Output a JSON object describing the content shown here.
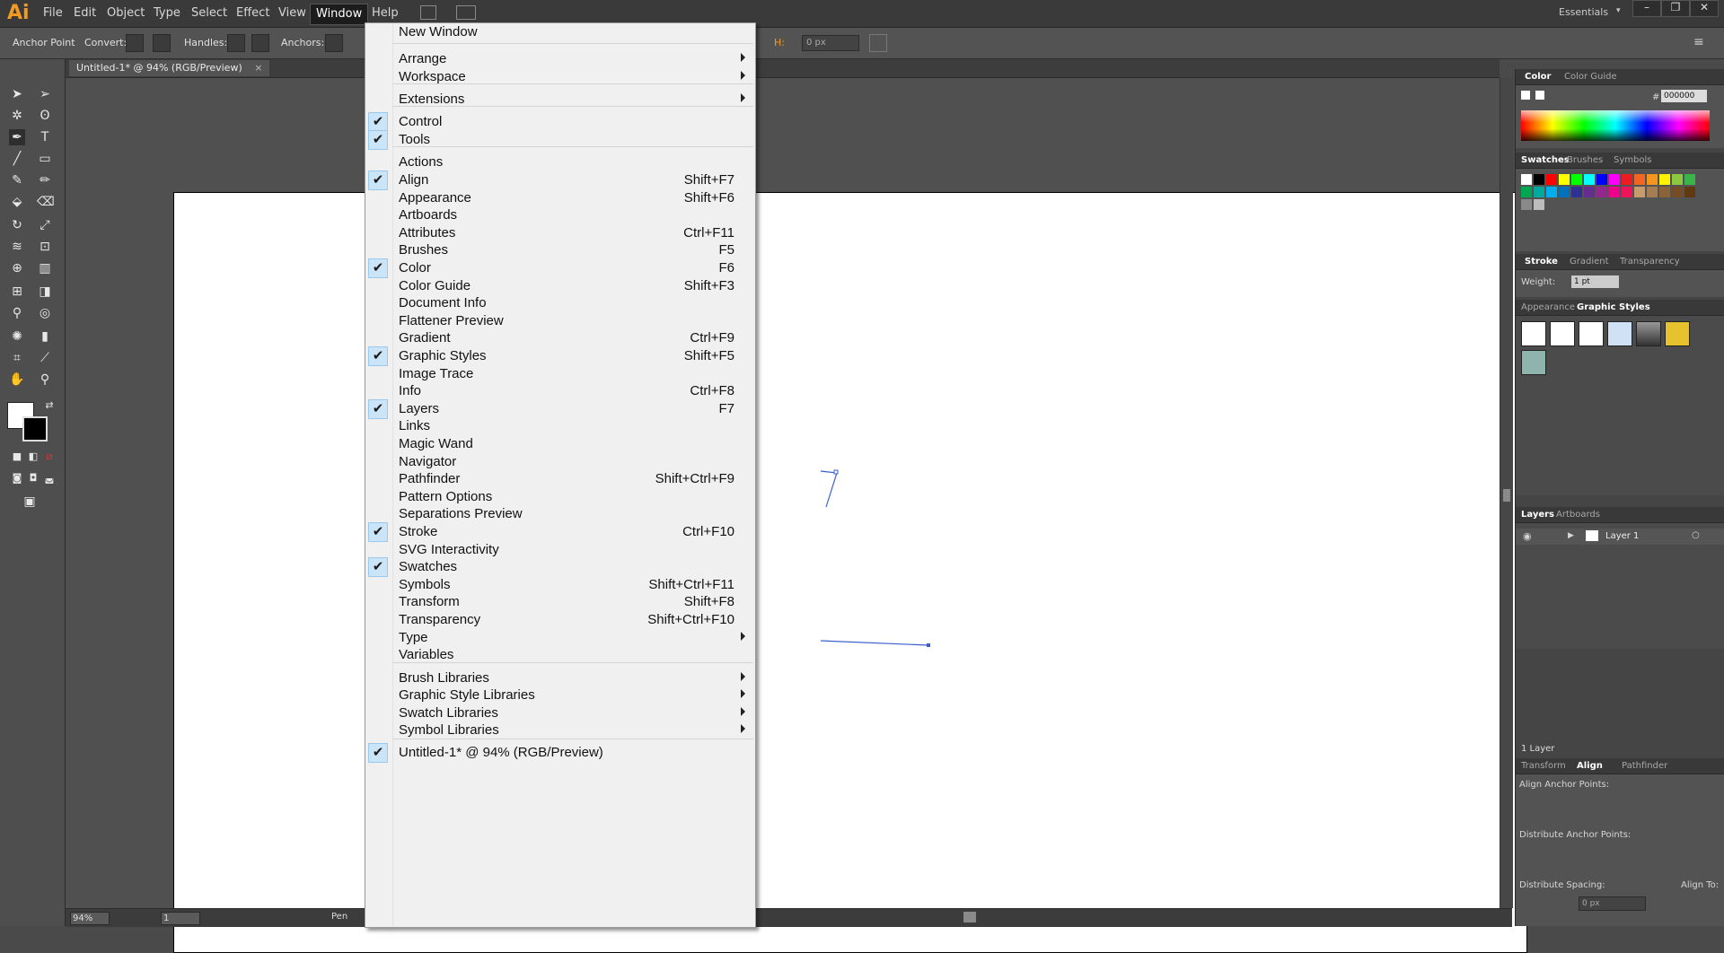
{
  "app": {
    "logo": "Ai",
    "menus": [
      "File",
      "Edit",
      "Object",
      "Type",
      "Select",
      "Effect",
      "View",
      "Window",
      "Help"
    ],
    "active_menu": "Window",
    "workspace": "Essentials",
    "window_buttons": [
      "–",
      "❐",
      "✕"
    ]
  },
  "controlbar": {
    "label": "Anchor Point",
    "convert": "Convert:",
    "handles": "Handles:",
    "anchors": "Anchors:",
    "h_label": "H:",
    "h_value": "0 px"
  },
  "document": {
    "tab": "Untitled-1* @ 94% (RGB/Preview)",
    "zoom": "94%",
    "artboard_num": "1",
    "status_tool": "Pen"
  },
  "panels": {
    "color": {
      "tabs": [
        "Color",
        "Color Guide"
      ],
      "hex_symbol": "#",
      "hex": "000000"
    },
    "swatches": {
      "tabs": [
        "Swatches",
        "Brushes",
        "Symbols"
      ]
    },
    "stroke": {
      "tabs": [
        "Stroke",
        "Gradient",
        "Transparency"
      ],
      "weight_label": "Weight:",
      "weight": "1 pt"
    },
    "graphic_styles": {
      "tabs": [
        "Appearance",
        "Graphic Styles"
      ]
    },
    "layers": {
      "tabs": [
        "Layers",
        "Artboards"
      ],
      "layer_name": "Layer 1",
      "count": "1 Layer"
    },
    "align": {
      "tabs": [
        "Transform",
        "Align",
        "Pathfinder"
      ],
      "align_anchor": "Align Anchor Points:",
      "distribute_anchor": "Distribute Anchor Points:",
      "distribute_spacing": "Distribute Spacing:",
      "align_to": "Align To:",
      "spacing_value": "0 px"
    }
  },
  "window_menu": {
    "items": [
      {
        "label": "New Window",
        "shortcut": "",
        "checked": false,
        "submenu": false
      },
      {
        "label": "Arrange",
        "shortcut": "",
        "checked": false,
        "submenu": true
      },
      {
        "label": "Workspace",
        "shortcut": "",
        "checked": false,
        "submenu": true
      },
      {
        "label": "Extensions",
        "shortcut": "",
        "checked": false,
        "submenu": true
      },
      {
        "label": "Control",
        "shortcut": "",
        "checked": true,
        "submenu": false
      },
      {
        "label": "Tools",
        "shortcut": "",
        "checked": true,
        "submenu": false
      },
      {
        "label": "Actions",
        "shortcut": "",
        "checked": false,
        "submenu": false
      },
      {
        "label": "Align",
        "shortcut": "Shift+F7",
        "checked": true,
        "submenu": false
      },
      {
        "label": "Appearance",
        "shortcut": "Shift+F6",
        "checked": false,
        "submenu": false
      },
      {
        "label": "Artboards",
        "shortcut": "",
        "checked": false,
        "submenu": false
      },
      {
        "label": "Attributes",
        "shortcut": "Ctrl+F11",
        "checked": false,
        "submenu": false
      },
      {
        "label": "Brushes",
        "shortcut": "F5",
        "checked": false,
        "submenu": false
      },
      {
        "label": "Color",
        "shortcut": "F6",
        "checked": true,
        "submenu": false
      },
      {
        "label": "Color Guide",
        "shortcut": "Shift+F3",
        "checked": false,
        "submenu": false
      },
      {
        "label": "Document Info",
        "shortcut": "",
        "checked": false,
        "submenu": false
      },
      {
        "label": "Flattener Preview",
        "shortcut": "",
        "checked": false,
        "submenu": false
      },
      {
        "label": "Gradient",
        "shortcut": "Ctrl+F9",
        "checked": false,
        "submenu": false
      },
      {
        "label": "Graphic Styles",
        "shortcut": "Shift+F5",
        "checked": true,
        "submenu": false
      },
      {
        "label": "Image Trace",
        "shortcut": "",
        "checked": false,
        "submenu": false
      },
      {
        "label": "Info",
        "shortcut": "Ctrl+F8",
        "checked": false,
        "submenu": false
      },
      {
        "label": "Layers",
        "shortcut": "F7",
        "checked": true,
        "submenu": false
      },
      {
        "label": "Links",
        "shortcut": "",
        "checked": false,
        "submenu": false
      },
      {
        "label": "Magic Wand",
        "shortcut": "",
        "checked": false,
        "submenu": false
      },
      {
        "label": "Navigator",
        "shortcut": "",
        "checked": false,
        "submenu": false
      },
      {
        "label": "Pathfinder",
        "shortcut": "Shift+Ctrl+F9",
        "checked": false,
        "submenu": false
      },
      {
        "label": "Pattern Options",
        "shortcut": "",
        "checked": false,
        "submenu": false
      },
      {
        "label": "Separations Preview",
        "shortcut": "",
        "checked": false,
        "submenu": false
      },
      {
        "label": "Stroke",
        "shortcut": "Ctrl+F10",
        "checked": true,
        "submenu": false
      },
      {
        "label": "SVG Interactivity",
        "shortcut": "",
        "checked": false,
        "submenu": false
      },
      {
        "label": "Swatches",
        "shortcut": "",
        "checked": true,
        "submenu": false
      },
      {
        "label": "Symbols",
        "shortcut": "Shift+Ctrl+F11",
        "checked": false,
        "submenu": false
      },
      {
        "label": "Transform",
        "shortcut": "Shift+F8",
        "checked": false,
        "submenu": false
      },
      {
        "label": "Transparency",
        "shortcut": "Shift+Ctrl+F10",
        "checked": false,
        "submenu": false
      },
      {
        "label": "Type",
        "shortcut": "",
        "checked": false,
        "submenu": true
      },
      {
        "label": "Variables",
        "shortcut": "",
        "checked": false,
        "submenu": false
      },
      {
        "label": "Brush Libraries",
        "shortcut": "",
        "checked": false,
        "submenu": true
      },
      {
        "label": "Graphic Style Libraries",
        "shortcut": "",
        "checked": false,
        "submenu": true
      },
      {
        "label": "Swatch Libraries",
        "shortcut": "",
        "checked": false,
        "submenu": true
      },
      {
        "label": "Symbol Libraries",
        "shortcut": "",
        "checked": false,
        "submenu": true
      },
      {
        "label": "Untitled-1* @ 94% (RGB/Preview)",
        "shortcut": "",
        "checked": true,
        "submenu": false
      }
    ]
  },
  "colors": {
    "accent": "#f39a24",
    "check_bg": "#cce4f7",
    "swatches": [
      "#ffffff",
      "#000000",
      "#ff0000",
      "#ffff00",
      "#00ff00",
      "#00ffff",
      "#0000ff",
      "#ff00ff",
      "#ed1c24",
      "#f26522",
      "#f7941d",
      "#fff200",
      "#8dc63f",
      "#39b54a",
      "#00a651",
      "#00a99d",
      "#00aeef",
      "#0072bc",
      "#2e3192",
      "#662d91",
      "#92278f",
      "#ec008c",
      "#ed145b",
      "#c69c6d",
      "#a67c52",
      "#8c6239",
      "#754c24",
      "#603913",
      "#898989",
      "#bcbcbc"
    ]
  }
}
